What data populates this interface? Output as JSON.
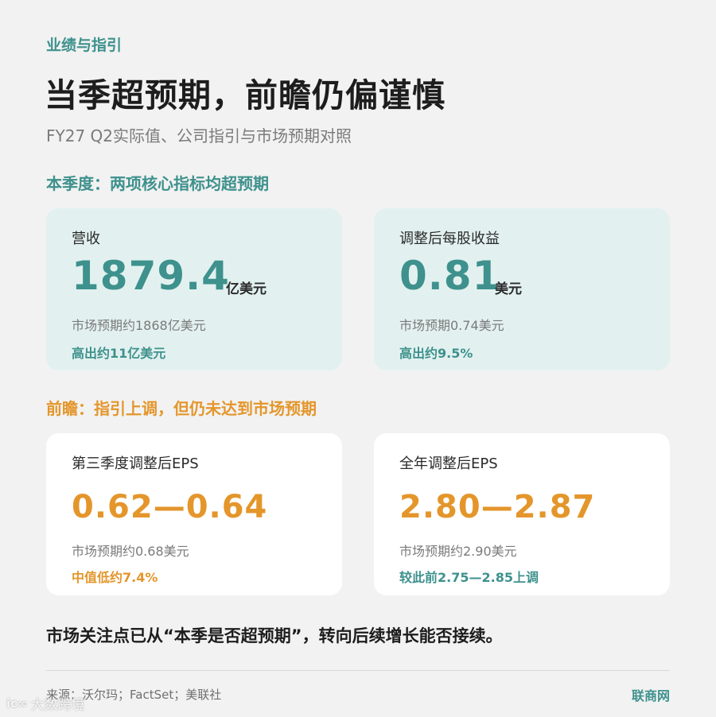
{
  "kicker": "业绩与指引",
  "title": "当季超预期，前瞻仍偏谨慎",
  "subtitle": "FY27 Q2实际值、公司指引与市场预期对照",
  "section_current": "本季度：两项核心指标均超预期",
  "section_outlook": "前瞻：指引上调，但仍未达到市场预期",
  "cards_current": [
    {
      "label": "营收",
      "value": "1879.4",
      "unit": "亿美元",
      "expectation": "市场预期约1868亿美元",
      "beat": "高出约11亿美元"
    },
    {
      "label": "调整后每股收益",
      "value": "0.81",
      "unit": "美元",
      "expectation": "市场预期0.74美元",
      "beat": "高出约9.5%"
    }
  ],
  "cards_outlook": [
    {
      "label": "第三季度调整后EPS",
      "value": "0.62—0.64",
      "expectation": "市场预期约0.68美元",
      "note": "中值低约7.4%"
    },
    {
      "label": "全年调整后EPS",
      "value": "2.80—2.87",
      "expectation": "市场预期约2.90美元",
      "note": "较此前2.75—2.85上调"
    }
  ],
  "conclusion": "市场关注点已从“本季是否超预期”，转向后续增长能否接续。",
  "source": "来源：沃尔玛；FactSet；美联社",
  "brand": "联商网",
  "watermark": {
    "logo": "ic∞",
    "text": "大数跨境"
  },
  "colors": {
    "teal": "#3e918d",
    "orange": "#e4962b",
    "teal_card_bg": "#e2f1ef"
  }
}
